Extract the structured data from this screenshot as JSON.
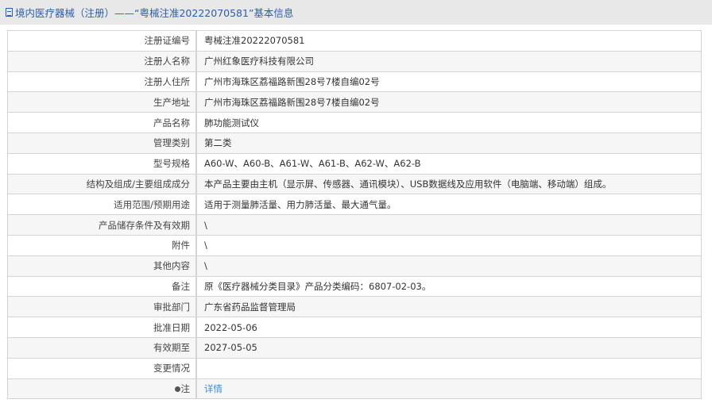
{
  "header": {
    "title": "境内医疗器械（注册）——“粤械注准20222070581”基本信息"
  },
  "rows": [
    {
      "label": "注册证编号",
      "value": "粤械注准20222070581"
    },
    {
      "label": "注册人名称",
      "value": "广州红象医疗科技有限公司"
    },
    {
      "label": "注册人住所",
      "value": "广州市海珠区荔福路新围28号7楼自编02号"
    },
    {
      "label": "生产地址",
      "value": "广州市海珠区荔福路新围28号7楼自编02号"
    },
    {
      "label": "产品名称",
      "value": "肺功能测试仪"
    },
    {
      "label": "管理类别",
      "value": "第二类"
    },
    {
      "label": "型号规格",
      "value": "A60-W、A60-B、A61-W、A61-B、A62-W、A62-B"
    },
    {
      "label": "结构及组成/主要组成成分",
      "value": "本产品主要由主机（显示屏、传感器、通讯模块）、USB数据线及应用软件（电脑端、移动端）组成。"
    },
    {
      "label": "适用范围/预期用途",
      "value": "适用于测量肺活量、用力肺活量、最大通气量。"
    },
    {
      "label": "产品储存条件及有效期",
      "value": "\\"
    },
    {
      "label": "附件",
      "value": "\\"
    },
    {
      "label": "其他内容",
      "value": "\\"
    },
    {
      "label": "备注",
      "value": "原《医疗器械分类目录》产品分类编码：6807-02-03。"
    },
    {
      "label": "审批部门",
      "value": "广东省药品监督管理局"
    },
    {
      "label": "批准日期",
      "value": "2022-05-06"
    },
    {
      "label": "有效期至",
      "value": "2027-05-05"
    },
    {
      "label": "变更情况",
      "value": ""
    },
    {
      "label": "注",
      "value": "详情"
    }
  ]
}
